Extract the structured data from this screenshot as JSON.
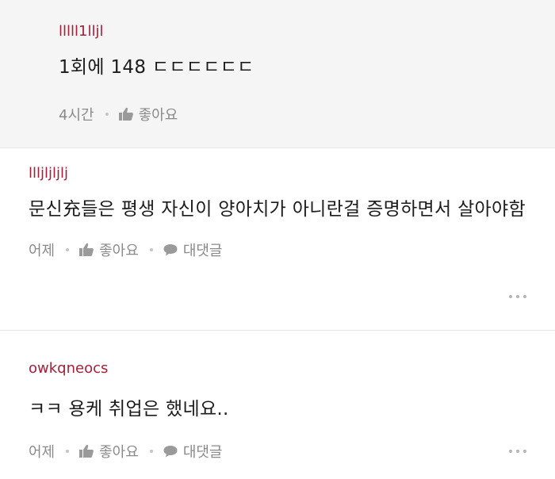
{
  "comments": [
    {
      "author": "lllll1lljl",
      "text": "1회에 148 ㄷㄷㄷㄷㄷㄷ",
      "time": "4시간",
      "like_label": "좋아요"
    },
    {
      "author": "llljljljlj",
      "text": "문신充들은 평생 자신이 양아치가 아니란걸 증명하면서 살아야함",
      "time": "어제",
      "like_label": "좋아요",
      "reply_label": "대댓글"
    },
    {
      "author": "owkqneocs",
      "text": "ㅋㅋ 용케 취업은 했네요..",
      "time": "어제",
      "like_label": "좋아요",
      "reply_label": "대댓글"
    }
  ],
  "icons": {
    "like": "thumbs-up-icon",
    "reply": "speech-bubble-icon",
    "more": "more-dots-icon"
  },
  "colors": {
    "author": "#a3203a",
    "meta": "#8a8a8a",
    "reply_background": "#f5f5f5"
  }
}
